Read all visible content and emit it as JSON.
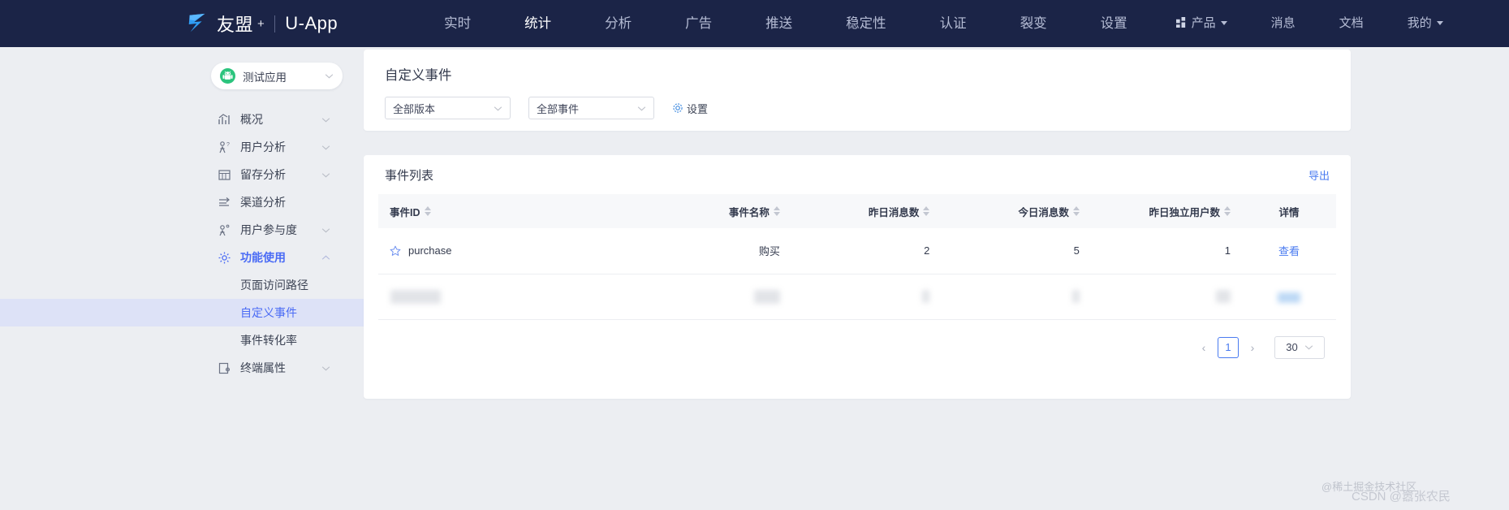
{
  "brand": {
    "name": "友盟",
    "plus": "+",
    "product": "U-App",
    "logo_icon": "umeng-logo-icon",
    "accent_dark": "#1b2447"
  },
  "topnav": {
    "items": [
      {
        "label": "实时",
        "active": false
      },
      {
        "label": "统计",
        "active": true
      },
      {
        "label": "分析",
        "active": false
      },
      {
        "label": "广告",
        "active": false
      },
      {
        "label": "推送",
        "active": false
      },
      {
        "label": "稳定性",
        "active": false
      },
      {
        "label": "认证",
        "active": false
      },
      {
        "label": "裂变",
        "active": false
      },
      {
        "label": "设置",
        "active": false
      }
    ],
    "right": [
      {
        "label": "产品",
        "icon": "grid-icon",
        "caret": true
      },
      {
        "label": "消息",
        "icon": "",
        "caret": false
      },
      {
        "label": "文档",
        "icon": "",
        "caret": false
      },
      {
        "label": "我的",
        "icon": "",
        "caret": true
      }
    ]
  },
  "sidebar": {
    "app_selector": {
      "label": "测试应用",
      "icon": "android-icon"
    },
    "items": [
      {
        "label": "概况",
        "icon": "trend-chart-icon",
        "expandable": true,
        "open": false
      },
      {
        "label": "用户分析",
        "icon": "user-question-icon",
        "expandable": true,
        "open": false
      },
      {
        "label": "留存分析",
        "icon": "grid-table-icon",
        "expandable": true,
        "open": false
      },
      {
        "label": "渠道分析",
        "icon": "channel-icon",
        "expandable": false,
        "open": false
      },
      {
        "label": "用户参与度",
        "icon": "user-engage-icon",
        "expandable": true,
        "open": false
      },
      {
        "label": "功能使用",
        "icon": "gear-icon",
        "expandable": true,
        "open": true
      }
    ],
    "submenu": [
      {
        "label": "页面访问路径",
        "selected": false
      },
      {
        "label": "自定义事件",
        "selected": true
      },
      {
        "label": "事件转化率",
        "selected": false
      }
    ],
    "items_after": [
      {
        "label": "终端属性",
        "icon": "device-icon",
        "expandable": true,
        "open": false
      }
    ]
  },
  "filters": {
    "title": "自定义事件",
    "version_select": {
      "value": "全部版本"
    },
    "event_select": {
      "value": "全部事件"
    },
    "settings_label": "设置",
    "settings_icon": "gear-icon"
  },
  "event_list": {
    "title": "事件列表",
    "export_label": "导出",
    "columns": [
      {
        "label": "事件ID",
        "sortable": true,
        "align": "left"
      },
      {
        "label": "事件名称",
        "sortable": true,
        "align": "right"
      },
      {
        "label": "昨日消息数",
        "sortable": true,
        "align": "right"
      },
      {
        "label": "今日消息数",
        "sortable": true,
        "align": "right"
      },
      {
        "label": "昨日独立用户数",
        "sortable": true,
        "align": "right"
      },
      {
        "label": "详情",
        "sortable": false,
        "align": "center"
      }
    ],
    "rows": [
      {
        "redacted": false,
        "star_icon": "star-outline-icon",
        "event_id": "purchase",
        "event_name": "购买",
        "yesterday_messages": "2",
        "today_messages": "5",
        "yesterday_unique_users": "1",
        "detail_label": "查看"
      },
      {
        "redacted": true,
        "star_icon": "star-outline-icon",
        "event_id": "",
        "event_name": "",
        "yesterday_messages": "",
        "today_messages": "",
        "yesterday_unique_users": "",
        "detail_label": ""
      }
    ],
    "pagination": {
      "prev": "‹",
      "current_page": "1",
      "next": "›",
      "page_size": "30"
    }
  },
  "watermarks": {
    "primary": "@稀土掘金技术社区",
    "secondary": "CSDN @嚣张农民"
  },
  "colors": {
    "link_blue": "#4a7bf0",
    "active_blue": "#4a6bf5",
    "selected_bg": "#dde2f7",
    "android_green": "#3ddc84"
  }
}
